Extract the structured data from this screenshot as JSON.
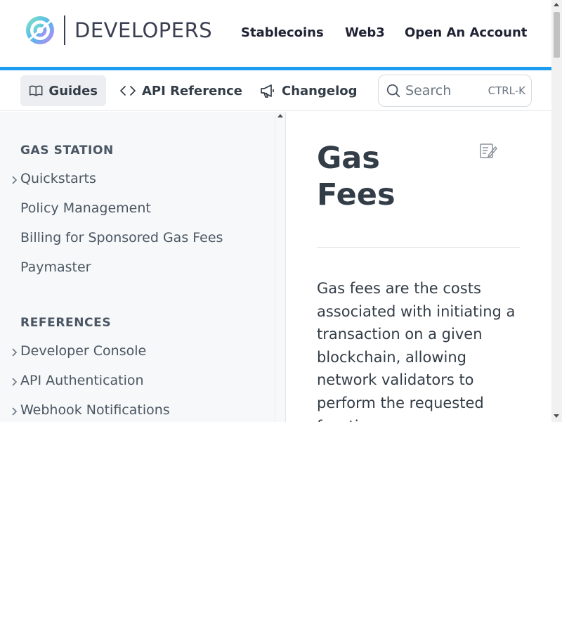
{
  "header": {
    "logo_text": "DEVELOPERS",
    "nav": [
      "Stablecoins",
      "Web3",
      "Open An Account"
    ]
  },
  "toolbar": {
    "tabs": [
      {
        "label": "Guides",
        "icon": "book-open-icon",
        "active": true
      },
      {
        "label": "API Reference",
        "icon": "code-brackets-icon",
        "active": false
      },
      {
        "label": "Changelog",
        "icon": "megaphone-icon",
        "active": false
      }
    ],
    "search": {
      "placeholder": "Search",
      "shortcut": "CTRL-K"
    }
  },
  "sidebar": {
    "sections": [
      {
        "heading": "GAS STATION",
        "items": [
          {
            "label": "Quickstarts",
            "expandable": true
          },
          {
            "label": "Policy Management",
            "expandable": false
          },
          {
            "label": "Billing for Sponsored Gas Fees",
            "expandable": false
          },
          {
            "label": "Paymaster",
            "expandable": false
          }
        ]
      },
      {
        "heading": "REFERENCES",
        "items": [
          {
            "label": "Developer Console",
            "expandable": true
          },
          {
            "label": "API Authentication",
            "expandable": true
          },
          {
            "label": "Webhook Notifications",
            "expandable": true
          }
        ]
      }
    ]
  },
  "main": {
    "title": "Gas Fees",
    "body": "Gas fees are the costs associated with initiating a transaction on a given blockchain, allowing network validators to perform the requested function."
  },
  "colors": {
    "accent_rule": "#1e9df0",
    "text": "#333d47",
    "sidebar_bg": "#f7f8f9",
    "active_tab_bg": "#eceef1"
  }
}
